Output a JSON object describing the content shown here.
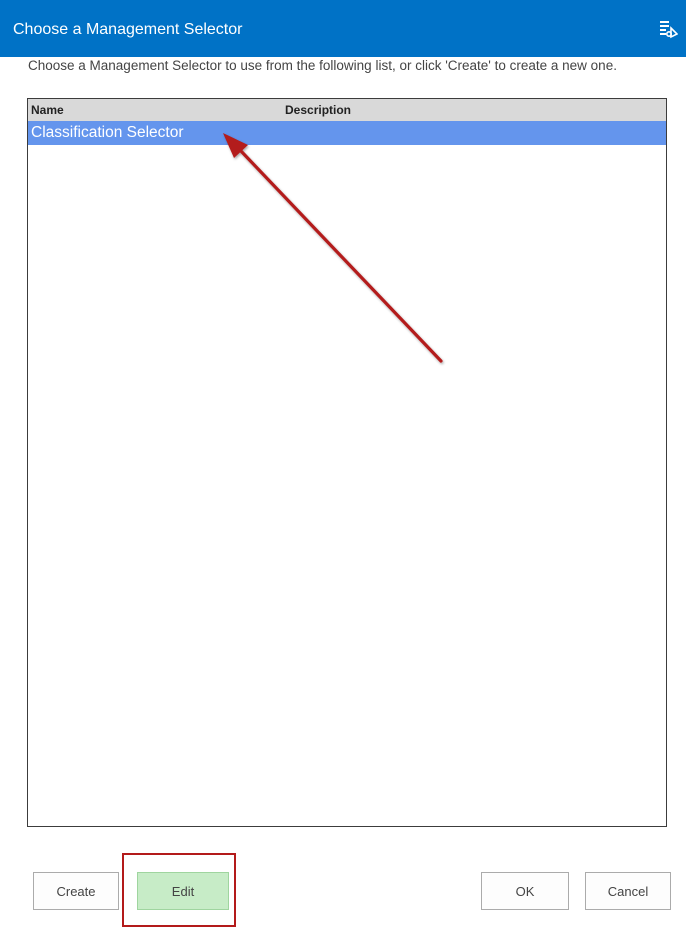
{
  "dialog": {
    "title": "Choose a Management Selector",
    "title_icon": "selector-list-icon",
    "instructions": "Choose a Management Selector to use from the following list, or click 'Create' to create a new one."
  },
  "list": {
    "columns": [
      "Name",
      "Description"
    ],
    "rows": [
      {
        "name": "Classification Selector",
        "description": "",
        "selected": true
      }
    ]
  },
  "buttons": {
    "create": "Create",
    "edit": "Edit",
    "ok": "OK",
    "cancel": "Cancel"
  },
  "colors": {
    "titlebar": "#0072c6",
    "selected_row": "#6495ed",
    "edit_button": "#c7ecc7",
    "annotation": "#b31a1a"
  }
}
